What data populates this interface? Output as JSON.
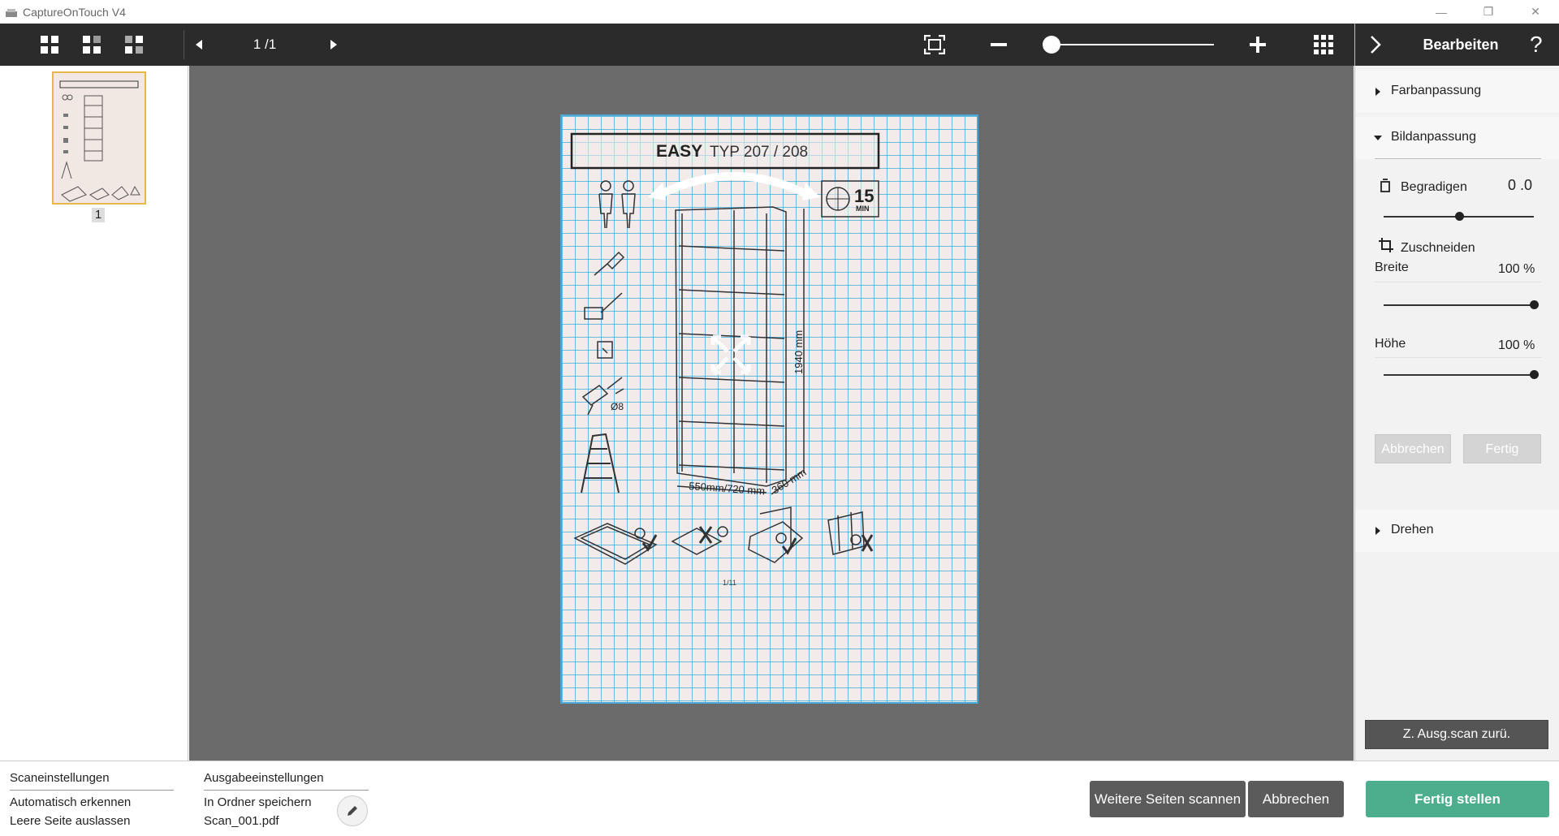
{
  "window": {
    "title": "CaptureOnTouch V4",
    "minimize": "—",
    "restore": "❐",
    "close": "✕"
  },
  "toolbar": {
    "page_indicator": "1 /1"
  },
  "thumbnails": [
    {
      "page_number": "1"
    }
  ],
  "document": {
    "title_bold": "EASY",
    "title_rest": "TYP 207 / 208",
    "time_value": "15",
    "time_unit": "MIN",
    "height_label": "1940 mm",
    "width_label": "550mm/720 mm",
    "depth_label": "360 mm",
    "drill_label": "Ø8",
    "page_footer": "1/11"
  },
  "right_panel": {
    "header_title": "Bearbeiten",
    "help": "?",
    "sections": {
      "farbanpassung": "Farbanpassung",
      "bildanpassung": "Bildanpassung",
      "drehen": "Drehen"
    },
    "begradigen": {
      "label": "Begradigen",
      "value": "0 .0",
      "slider_level": 0.5
    },
    "zuschneiden": {
      "label": "Zuschneiden",
      "breite_label": "Breite",
      "breite_value": "100 %",
      "breite_level": 1.0,
      "hoehe_label": "Höhe",
      "hoehe_value": "100 %",
      "hoehe_level": 1.0
    },
    "buttons": {
      "cancel": "Abbrechen",
      "done": "Fertig",
      "reset": "Z. Ausg.scan zurü."
    }
  },
  "bottom": {
    "scan_settings_title": "Scaneinstellungen",
    "scan_setting_1": "Automatisch erkennen",
    "scan_setting_2": "Leere Seite auslassen",
    "output_settings_title": "Ausgabeeinstellungen",
    "output_setting_1": "In Ordner speichern",
    "output_setting_2": "Scan_001.pdf",
    "btn_more_pages": "Weitere Seiten scannen",
    "btn_cancel": "Abbrechen",
    "btn_finish": "Fertig stellen"
  },
  "colors": {
    "toolbar_bg": "#2b2b2b",
    "viewer_bg": "#6b6b6b",
    "primary_button": "#4cae8c",
    "thumb_highlight": "#e8b64a"
  }
}
